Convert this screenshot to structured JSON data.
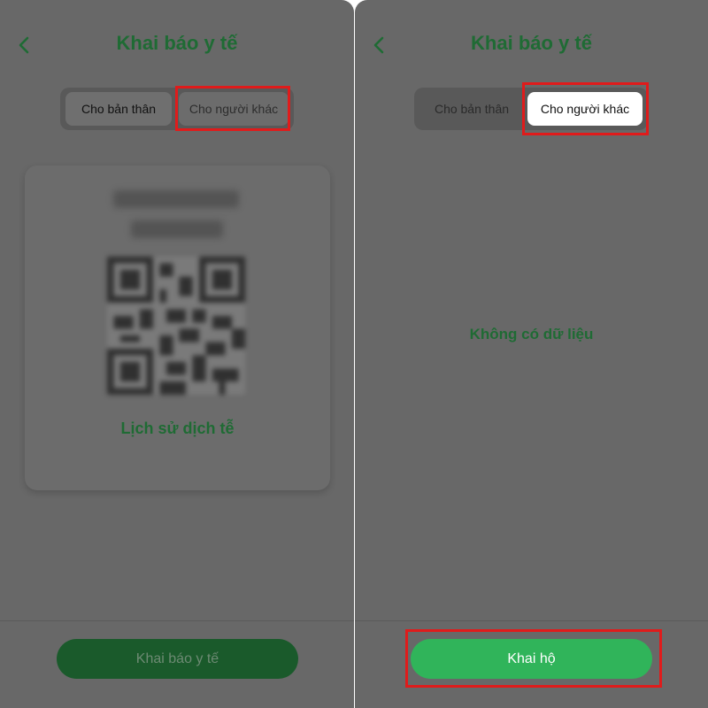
{
  "left": {
    "title": "Khai báo y tế",
    "tabs": {
      "self": "Cho bản thân",
      "other": "Cho người khác"
    },
    "history_link": "Lịch sử dịch tễ",
    "cta": "Khai báo y tế"
  },
  "right": {
    "title": "Khai báo y tế",
    "tabs": {
      "self": "Cho bản thân",
      "other": "Cho người khác"
    },
    "empty_text": "Không có dữ liệu",
    "cta": "Khai hộ"
  },
  "colors": {
    "brand_green": "#1f6b34",
    "cta_green": "#30b45a",
    "highlight_red": "#e01b1b",
    "overlay": "#686868"
  },
  "icons": {
    "back": "chevron-left-icon",
    "qr": "qr-code-icon"
  }
}
